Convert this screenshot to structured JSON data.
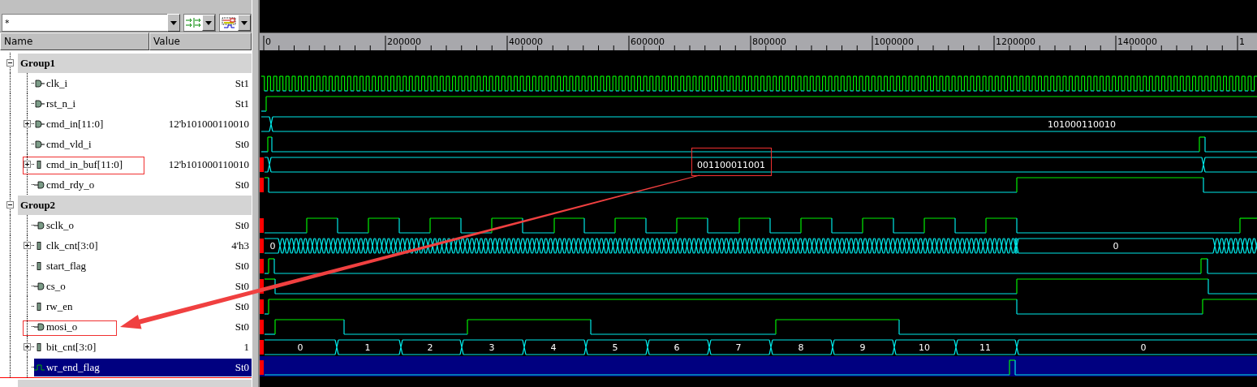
{
  "filter_field": {
    "value": "*"
  },
  "columns": [
    "Name",
    "Value"
  ],
  "ruler": {
    "ticks": [
      "0",
      "200000",
      "400000",
      "600000",
      "800000",
      "1000000",
      "1200000",
      "1400000",
      "1"
    ]
  },
  "groups": [
    {
      "name": "Group1",
      "expanded": true,
      "signals": [
        {
          "name": "clk_i",
          "kind": "input",
          "value": "St1",
          "selected": false
        },
        {
          "name": "rst_n_i",
          "kind": "input",
          "value": "St1",
          "selected": false
        },
        {
          "name": "cmd_in[11:0]",
          "kind": "input",
          "value": "12'b101000110010",
          "expanded": false,
          "selected": false,
          "labels": [
            "101000110010"
          ]
        },
        {
          "name": "cmd_vld_i",
          "kind": "input",
          "value": "St0",
          "selected": false
        },
        {
          "name": "cmd_in_buf[11:0]",
          "kind": "internal",
          "value": "12'b101000110010",
          "expanded": false,
          "selected": false,
          "labels": [
            "001100011001"
          ]
        },
        {
          "name": "cmd_rdy_o",
          "kind": "output",
          "value": "St0",
          "selected": false
        }
      ]
    },
    {
      "name": "Group2",
      "expanded": true,
      "signals": [
        {
          "name": "sclk_o",
          "kind": "output",
          "value": "St0",
          "selected": false
        },
        {
          "name": "clk_cnt[3:0]",
          "kind": "internal",
          "value": "4'h3",
          "expanded": false,
          "selected": false,
          "labels": [
            "0",
            "0"
          ]
        },
        {
          "name": "start_flag",
          "kind": "internal",
          "value": "St0",
          "selected": false
        },
        {
          "name": "cs_o",
          "kind": "output",
          "value": "St0",
          "selected": false
        },
        {
          "name": "rw_en",
          "kind": "internal",
          "value": "St0",
          "selected": false
        },
        {
          "name": "mosi_o",
          "kind": "output",
          "value": "St0",
          "selected": false
        },
        {
          "name": "bit_cnt[3:0]",
          "kind": "internal",
          "value": "1",
          "expanded": false,
          "selected": false,
          "labels": [
            "0",
            "1",
            "2",
            "3",
            "4",
            "5",
            "6",
            "7",
            "8",
            "9",
            "10",
            "11",
            "0"
          ]
        },
        {
          "name": "wr_end_flag",
          "kind": "wave",
          "value": "St0",
          "selected": true
        }
      ]
    }
  ]
}
